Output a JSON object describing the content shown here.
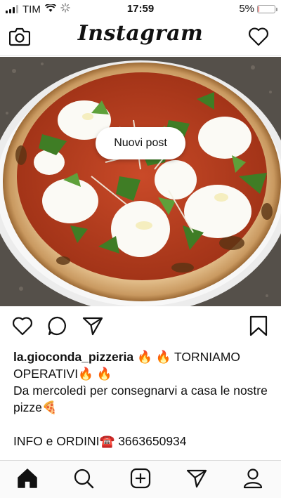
{
  "status_bar": {
    "carrier": "TIM",
    "time": "17:59",
    "battery_percent": "5%",
    "battery_level": 0.05,
    "battery_color": "#e0302e"
  },
  "header": {
    "title": "Instagram",
    "left_icon": "camera-icon",
    "right_icon": "heart-icon"
  },
  "post": {
    "new_posts_label": "Nuovi post",
    "actions": {
      "like_icon": "heart-icon",
      "comment_icon": "comment-icon",
      "share_icon": "paper-plane-icon",
      "save_icon": "bookmark-icon"
    },
    "caption": {
      "username": "la.gioconda_pizzeria",
      "line1_emoji": "🔥 🔥",
      "line1_text": "TORNIAMO OPERATIVI",
      "line1_emoji_end": "🔥 🔥",
      "line2": "Da mercoledì  per consegnarvi a casa le nostre pizze",
      "line2_emoji": "🍕",
      "line3_text": "INFO e ORDINI",
      "line3_emoji": "☎️",
      "phone": "3663650934"
    }
  },
  "bottom_nav": {
    "items": [
      "home-icon",
      "search-icon",
      "new-post-icon",
      "direct-icon",
      "profile-icon"
    ]
  }
}
